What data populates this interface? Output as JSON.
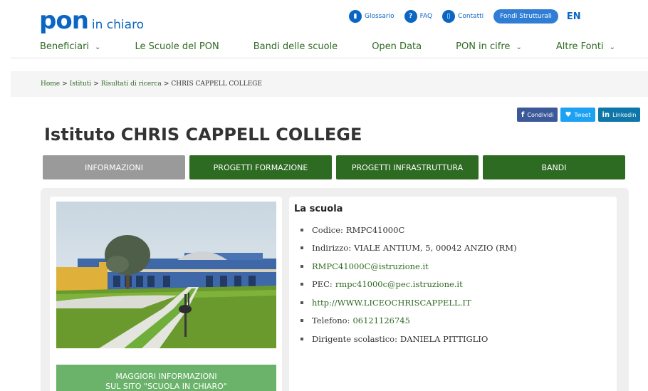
{
  "header": {
    "logo_main": "pon",
    "logo_sub": "in chiaro",
    "links": [
      {
        "label": "Glossario",
        "icon": "book-icon",
        "glyph": "▮"
      },
      {
        "label": "FAQ",
        "icon": "question-icon",
        "glyph": "?"
      },
      {
        "label": "Contatti",
        "icon": "contact-icon",
        "glyph": "▯"
      }
    ],
    "fondi_label": "Fondi Strutturali",
    "lang_label": "EN"
  },
  "nav": {
    "items": [
      {
        "label": "Beneficiari",
        "dropdown": true
      },
      {
        "label": "Le Scuole del PON",
        "dropdown": false
      },
      {
        "label": "Bandi delle scuole",
        "dropdown": false
      },
      {
        "label": "Open Data",
        "dropdown": false
      },
      {
        "label": "PON in cifre",
        "dropdown": true
      },
      {
        "label": "Altre Fonti",
        "dropdown": true
      }
    ]
  },
  "breadcrumb": {
    "home": "Home",
    "istituti": "Istituti",
    "risultati": "Risultati di ricerca",
    "current": "CHRIS CAPPELL COLLEGE",
    "sep": ">"
  },
  "share": {
    "facebook": "Condividi",
    "twitter": "Tweet",
    "linkedin": "Linkedin"
  },
  "page_title": "Istituto CHRIS CAPPELL COLLEGE",
  "tabs": [
    {
      "label": "INFORMAZIONI",
      "active": true
    },
    {
      "label": "PROGETTI FORMAZIONE",
      "active": false
    },
    {
      "label": "PROGETTI INFRASTRUTTURA",
      "active": false
    },
    {
      "label": "BANDI",
      "active": false
    }
  ],
  "more_info": {
    "line1": "MAGGIORI INFORMAZIONI",
    "line2": "SUL SITO \"SCUOLA IN CHIARO\""
  },
  "school": {
    "heading": "La scuola",
    "codice_label": "Codice:",
    "codice": "RMPC41000C",
    "indirizzo_label": "Indirizzo:",
    "indirizzo": "VIALE ANTIUM, 5, 00042 ANZIO (RM)",
    "email": "RMPC41000C@istruzione.it",
    "pec_label": "PEC:",
    "pec": "rmpc41000c@pec.istruzione.it",
    "website": "http://WWW.LICEOCHRISCAPPELL.IT",
    "telefono_label": "Telefono:",
    "telefono": "06121126745",
    "dirigente_label": "Dirigente scolastico:",
    "dirigente": "DANIELA PITTIGLIO"
  },
  "colors": {
    "brand_blue": "#0b66c3",
    "green": "#2e6b22",
    "tab_active": "#9a9a9a",
    "more_btn": "#6bb36b"
  }
}
